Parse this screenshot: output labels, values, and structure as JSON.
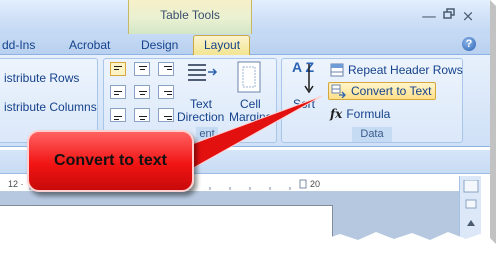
{
  "titlebar": {
    "context_title": "Table Tools",
    "minimize": "—",
    "close": "×"
  },
  "tabs": {
    "addins": "dd-Ins",
    "acrobat": "Acrobat",
    "design": "Design",
    "layout": "Layout",
    "help": "?"
  },
  "ribbon": {
    "distribute_rows": "istribute Rows",
    "distribute_columns": "istribute Columns",
    "text_direction_1": "Text",
    "text_direction_2": "Direction",
    "cell_margins_1": "Cell",
    "cell_margins_2": "Margins",
    "alignment_group": "ent",
    "sort_label": "Sort",
    "sort_az": "A Z",
    "repeat_header_rows": "Repeat Header Rows",
    "convert_to_text": "Convert to Text",
    "formula": "Formula",
    "fx": "fx",
    "data_group": "Data"
  },
  "ruler": {
    "left_label": "12 ·",
    "right_label": "20"
  },
  "callout": {
    "text": "Convert to text"
  },
  "colors": {
    "accent_red": "#f21414",
    "selected_gold": "#ffe08a",
    "ribbon_blue": "#d9e7f9"
  }
}
